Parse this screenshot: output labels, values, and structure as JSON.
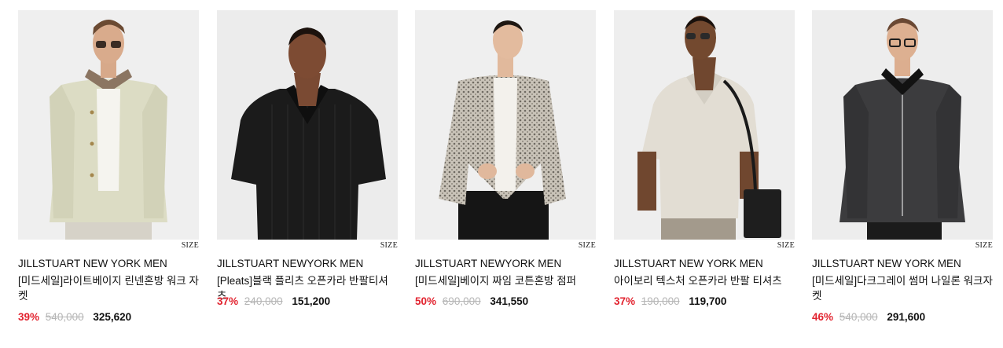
{
  "products": [
    {
      "size_label": "SIZE",
      "brand": "JILLSTUART NEW YORK MEN",
      "name": "[미드세일]라이트베이지 린넨혼방 워크 자켓",
      "discount": "39%",
      "original_price": "540,000",
      "sale_price": "325,620",
      "image_bg": "#efefef",
      "garment_color": "#dcdcc4",
      "image_desc": "model-in-light-beige-work-jacket"
    },
    {
      "size_label": "SIZE",
      "brand": "JILLSTUART NEWYORK MEN",
      "name": "[Pleats]블랙 플리츠 오픈카라 반팔티셔츠",
      "discount": "37%",
      "original_price": "240,000",
      "sale_price": "151,200",
      "image_bg": "#ececec",
      "garment_color": "#1b1b1b",
      "image_desc": "model-in-black-pleated-shirt"
    },
    {
      "size_label": "SIZE",
      "brand": "JILLSTUART NEWYORK MEN",
      "name": "[미드세일]베이지 짜임 코튼혼방 점퍼",
      "discount": "50%",
      "original_price": "690,000",
      "sale_price": "341,550",
      "image_bg": "#efefef",
      "garment_color": "#b9b3a8",
      "image_desc": "model-in-beige-knit-jumper"
    },
    {
      "size_label": "SIZE",
      "brand": "JILLSTUART NEW YORK MEN",
      "name": "아이보리 텍스처 오픈카라 반팔 티셔츠",
      "discount": "37%",
      "original_price": "190,000",
      "sale_price": "119,700",
      "image_bg": "#eeeeee",
      "garment_color": "#e2ddd3",
      "image_desc": "model-in-ivory-textured-shirt"
    },
    {
      "size_label": "SIZE",
      "brand": "JILLSTUART NEW YORK MEN",
      "name": "[미드세일]다크그레이 썸머 나일론 워크자켓",
      "discount": "46%",
      "original_price": "540,000",
      "sale_price": "291,600",
      "image_bg": "#ededed",
      "garment_color": "#3c3c3e",
      "image_desc": "model-in-dark-grey-nylon-jacket"
    }
  ],
  "colors": {
    "discount": "#e2232f",
    "original_price": "#b5b5b5",
    "text": "#111111"
  }
}
